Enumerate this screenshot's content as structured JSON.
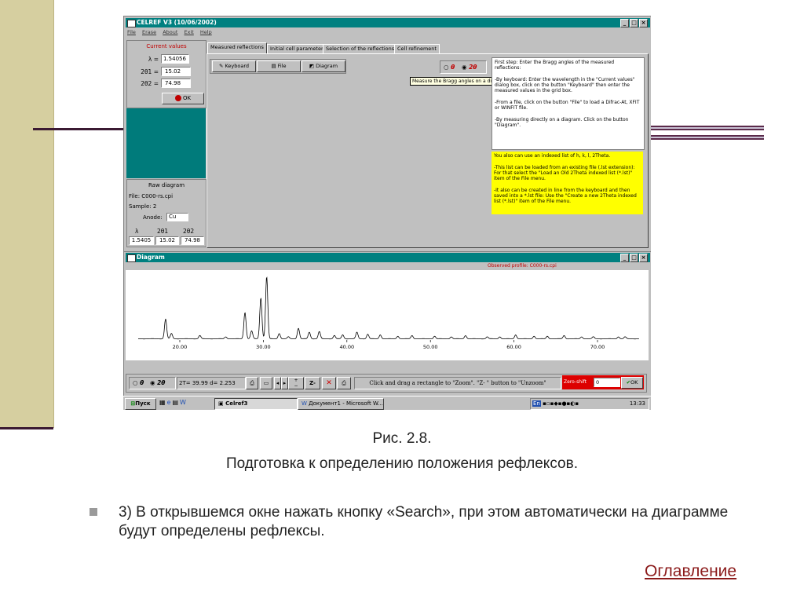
{
  "colors": {
    "slide_bar": "#d6cfa0",
    "deco": "#3b1a33",
    "title_bar": "#008080",
    "yellow_note": "#ffff00",
    "status_red": "#dd0000",
    "link": "#8b1a1a"
  },
  "main_window": {
    "title": "CELREF V3 (10/06/2002)",
    "menu": [
      "File",
      "Erase",
      "About",
      "Exit",
      "Help"
    ],
    "current_values": {
      "header": "Current values",
      "lambda_label": "λ =",
      "lambda_value": "1.54056",
      "two_theta1_label": "2θ1 =",
      "two_theta1_value": "15.02",
      "two_theta2_label": "2θ2 =",
      "two_theta2_value": "74.98",
      "ok_label": "OK"
    },
    "raw_diagram": {
      "header": "Raw diagram",
      "file": "File: C000-rs.cpi",
      "sample": "Sample: 2",
      "anode_label": "Anode:",
      "anode_value": "Cu",
      "col_headers": [
        "λ",
        "2θ1",
        "2θ2"
      ],
      "col_values": [
        "1.5405",
        "15.02",
        "74.98"
      ]
    },
    "tabs": [
      "Measured reflections",
      "Initial cell parameters",
      "Selection of the reflections",
      "Cell refinement"
    ],
    "buttons": {
      "keyboard": "Keyboard",
      "file": "File",
      "diagram": "Diagram"
    },
    "radio": {
      "theta": "θ",
      "two_theta": "2θ"
    },
    "tooltip": "Measure the Bragg angles on a diagram",
    "info_text": "First step: Enter the Bragg angles of the measured reflections:\n\n-By keyboard: Enter the wavelength in the \"Current values\" dialog box, click on the button \"Keyboard\" then enter the measured values in the grid box.\n\n-From a file, click on the button \"File\" to load a Difrac-At, XFIT or WINFIT file.\n\n-By measuring directly on a diagram. Click on the button \"Diagram\".",
    "yellow_text": "You also can use an indexed list of h, k, l, 2Theta.\n\n-This list can be loaded from an existing file (.lst extension): For that select the \"Load an Old 2Theta indexed list (*.lst)\" item of the File menu.\n\n-It also can be created in line from the keyboard and then saved into a *.lst file: Use the \"Create a new 2Theta indexed list (*.lst)\" item of the File menu."
  },
  "diagram_window": {
    "title": "Diagram",
    "observed_profile": "Observed profile: C000-rs.cpi",
    "x_ticks": [
      "20.00",
      "30.00",
      "40.00",
      "50.00",
      "60.00",
      "70.00"
    ],
    "status_readout": "2T= 39.99 d= 2.253",
    "z_minus": "Z-",
    "hint": "Click and drag a rectangle to \"Zoom\". \"Z- \" button to \"Unzoom\"",
    "zero_label": "Zero-shift",
    "zero_value": "0",
    "ok_label": "OK"
  },
  "chart_data": {
    "type": "line",
    "x_ticks": [
      "20.00",
      "30.00",
      "40.00",
      "50.00",
      "60.00",
      "70.00"
    ],
    "xlim": [
      15.02,
      74.98
    ],
    "ylim": [
      0,
      100
    ],
    "peaks": [
      {
        "x": 18.3,
        "y": 30
      },
      {
        "x": 19.0,
        "y": 8
      },
      {
        "x": 22.4,
        "y": 5
      },
      {
        "x": 25.5,
        "y": 3
      },
      {
        "x": 27.8,
        "y": 40
      },
      {
        "x": 28.6,
        "y": 12
      },
      {
        "x": 29.7,
        "y": 62
      },
      {
        "x": 30.4,
        "y": 94
      },
      {
        "x": 31.9,
        "y": 8
      },
      {
        "x": 33.0,
        "y": 3
      },
      {
        "x": 34.2,
        "y": 16
      },
      {
        "x": 35.5,
        "y": 10
      },
      {
        "x": 36.7,
        "y": 11
      },
      {
        "x": 38.5,
        "y": 5
      },
      {
        "x": 39.5,
        "y": 6
      },
      {
        "x": 41.2,
        "y": 10
      },
      {
        "x": 42.5,
        "y": 7
      },
      {
        "x": 44.0,
        "y": 6
      },
      {
        "x": 46.1,
        "y": 4
      },
      {
        "x": 47.8,
        "y": 5
      },
      {
        "x": 50.5,
        "y": 4
      },
      {
        "x": 52.5,
        "y": 3
      },
      {
        "x": 54.2,
        "y": 5
      },
      {
        "x": 56.8,
        "y": 3
      },
      {
        "x": 58.3,
        "y": 3
      },
      {
        "x": 60.2,
        "y": 6
      },
      {
        "x": 62.4,
        "y": 4
      },
      {
        "x": 64.0,
        "y": 4
      },
      {
        "x": 66.0,
        "y": 5
      },
      {
        "x": 68.1,
        "y": 3
      },
      {
        "x": 69.5,
        "y": 3
      },
      {
        "x": 72.5,
        "y": 3
      },
      {
        "x": 73.3,
        "y": 3
      }
    ]
  },
  "taskbar": {
    "start": "Пуск",
    "tasks": [
      "Celref3",
      "Документ1 - Microsoft W..."
    ],
    "tray_lang": "En",
    "clock": "13:33"
  },
  "slide": {
    "figure_label": "Рис. 2.8.",
    "figure_caption": "Подготовка к определению положения рефлексов.",
    "bullet_text": "3) В открывшемся окне нажать кнопку «Search», при этом автоматически на диаграмме будут определены рефлексы.",
    "toc_link": "Оглавление"
  }
}
